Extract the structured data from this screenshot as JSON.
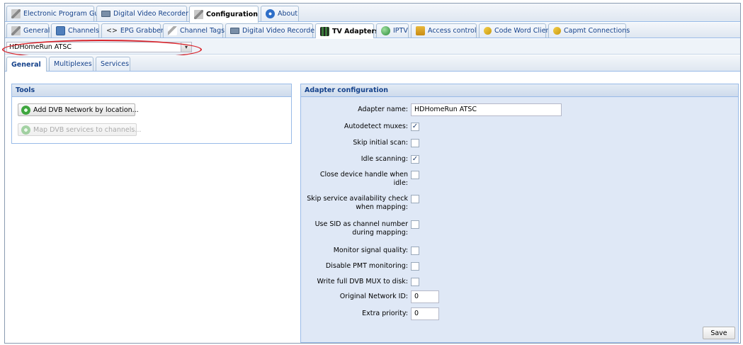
{
  "top_tabs": [
    {
      "label": "Electronic Program Guide",
      "icon": "wrench-icon"
    },
    {
      "label": "Digital Video Recorder",
      "icon": "tv-icon"
    },
    {
      "label": "Configuration",
      "icon": "wrench-icon",
      "active": true
    },
    {
      "label": "About",
      "icon": "about-icon"
    }
  ],
  "config_tabs": [
    {
      "label": "General",
      "icon": "wrench-icon"
    },
    {
      "label": "Channels",
      "icon": "channels-icon"
    },
    {
      "label": "EPG Grabber",
      "icon": "code-icon"
    },
    {
      "label": "Channel Tags",
      "icon": "tag-icon"
    },
    {
      "label": "Digital Video Recorder",
      "icon": "tv-icon"
    },
    {
      "label": "TV Adapters",
      "icon": "film-icon",
      "active": true
    },
    {
      "label": "IPTV",
      "icon": "globe-icon"
    },
    {
      "label": "Access control",
      "icon": "access-icon"
    },
    {
      "label": "Code Word Client",
      "icon": "key-icon"
    },
    {
      "label": "Capmt Connections",
      "icon": "key-icon"
    }
  ],
  "adapter_select": {
    "value": "HDHomeRun ATSC",
    "trigger": "▾"
  },
  "sub_tabs": [
    {
      "label": "General",
      "active": true
    },
    {
      "label": "Multiplexes"
    },
    {
      "label": "Services"
    }
  ],
  "tools": {
    "title": "Tools",
    "add_button": "Add DVB Network by location...",
    "map_button": "Map DVB services to channels..."
  },
  "adapter_config": {
    "title": "Adapter configuration",
    "adapter_name_label": "Adapter name:",
    "adapter_name_value": "HDHomeRun ATSC",
    "autodetect_label": "Autodetect muxes:",
    "skip_scan_label": "Skip initial scan:",
    "idle_scanning_label": "Idle scanning:",
    "close_handle_label_1": "Close device handle when",
    "close_handle_label_2": "idle:",
    "skip_service_label_1": "Skip service availability check",
    "skip_service_label_2": "when mapping:",
    "use_sid_label_1": "Use SID as channel number",
    "use_sid_label_2": "during mapping:",
    "monitor_label": "Monitor signal quality:",
    "disable_pmt_label": "Disable PMT monitoring:",
    "write_mux_label": "Write full DVB MUX to disk:",
    "network_id_label": "Original Network ID:",
    "network_id_value": "0",
    "priority_label": "Extra priority:",
    "priority_value": "0",
    "save_button": "Save",
    "checks": {
      "autodetect": true,
      "skip_scan": false,
      "idle_scanning": true,
      "close_handle": false,
      "skip_service": false,
      "use_sid": false,
      "monitor": false,
      "disable_pmt": false,
      "write_mux": false
    },
    "check_mark": "✓"
  }
}
